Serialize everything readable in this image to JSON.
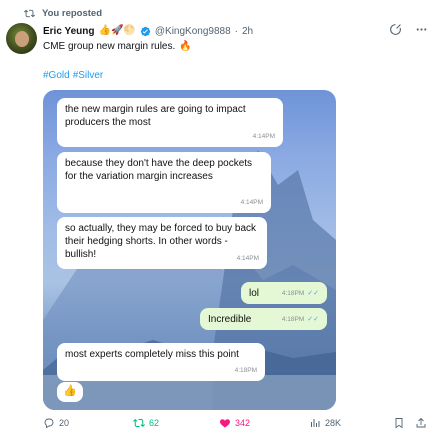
{
  "repost": {
    "text": "You reposted"
  },
  "author": {
    "name": "Eric Yeung",
    "emojis": "👍🚀🌕",
    "handle": "@KingKong9888",
    "separator": "·",
    "time": "2h"
  },
  "tweet": {
    "text": "CME group new margin rules.",
    "emoji": "🔥",
    "hashtags": [
      "#Gold",
      "#Silver"
    ]
  },
  "chat": {
    "messages": [
      {
        "text": "the new margin rules are going to impact producers the most",
        "time": "4:14PM"
      },
      {
        "text": "because they don't have the deep pockets for the variation margin increases",
        "time": "4:14PM"
      },
      {
        "text": "so actually, they may be forced to buy back their hedging shorts. In other words - bullish!",
        "time": "4:14PM"
      },
      {
        "text": "lol",
        "time": "4:18PM",
        "ticks": "✓✓"
      },
      {
        "text": "Incredible",
        "time": "4:18PM",
        "ticks": "✓✓"
      },
      {
        "text": "most experts completely miss this point",
        "time": "4:18PM"
      },
      {
        "text": "👍"
      }
    ]
  },
  "actions": {
    "replies": "20",
    "reposts": "62",
    "likes": "342",
    "views": "28K"
  },
  "colors": {
    "repost_green": "#00ba7c",
    "like_pink": "#f91880",
    "link_blue": "#1d9bf0",
    "outgoing_bubble": "#e4f8d5"
  }
}
